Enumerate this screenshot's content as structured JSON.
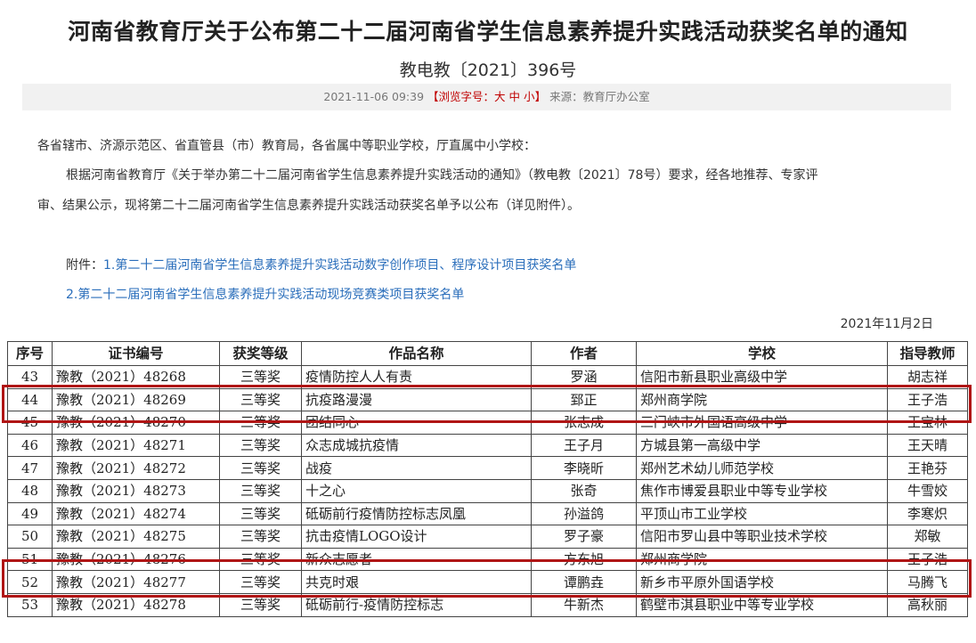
{
  "article": {
    "title": "河南省教育厅关于公布第二十二届河南省学生信息素养提升实践活动获奖名单的通知",
    "doc_no": "教电教〔2021〕396号",
    "datetime": "2021-11-06 09:39",
    "font_label_open": "【浏览字号：",
    "font_large": "大",
    "font_medium": "中",
    "font_small": "小",
    "font_label_close": "】",
    "source": "来源：教育厅办公室",
    "greeting": "各省辖市、济源示范区、省直管县（市）教育局，各省属中等职业学校，厅直属中小学校：",
    "body_line1": "根据河南省教育厅《关于举办第二十二届河南省学生信息素养提升实践活动的通知》（教电教〔2021〕78号）要求，经各地推荐、专家评",
    "body_line2": "审、结果公示，现将第二十二届河南省学生信息素养提升实践活动获奖名单予以公布（详见附件）。",
    "attach_label": "附件：",
    "attach1": "1.第二十二届河南省学生信息素养提升实践活动数字创作项目、程序设计项目获奖名单",
    "attach2": "2.第二十二届河南省学生信息素养提升实践活动现场竞赛类项目获奖名单",
    "date": "2021年11月2日"
  },
  "table": {
    "headers": [
      "序号",
      "证书编号",
      "获奖等级",
      "作品名称",
      "作者",
      "学校",
      "指导教师"
    ],
    "rows": [
      [
        "43",
        "豫教（2021）48268",
        "三等奖",
        "疫情防控人人有责",
        "罗涵",
        "信阳市新县职业高级中学",
        "胡志祥"
      ],
      [
        "44",
        "豫教（2021）48269",
        "三等奖",
        "抗疫路漫漫",
        "郅正",
        "郑州商学院",
        "王子浩"
      ],
      [
        "45",
        "豫教（2021）48270",
        "三等奖",
        "团结同心",
        "张志成",
        "三门峡市外国语高级中学",
        "王宝林"
      ],
      [
        "46",
        "豫教（2021）48271",
        "三等奖",
        "众志成城抗疫情",
        "王子月",
        "方城县第一高级中学",
        "王天晴"
      ],
      [
        "47",
        "豫教（2021）48272",
        "三等奖",
        "战疫",
        "李晓昕",
        "郑州艺术幼儿师范学校",
        "王艳芬"
      ],
      [
        "48",
        "豫教（2021）48273",
        "三等奖",
        "十之心",
        "张奇",
        "焦作市博爱县职业中等专业学校",
        "牛雪姣"
      ],
      [
        "49",
        "豫教（2021）48274",
        "三等奖",
        "砥砺前行疫情防控标志凤凰",
        "孙溢鸽",
        "平顶山市工业学校",
        "李寒炽"
      ],
      [
        "50",
        "豫教（2021）48275",
        "三等奖",
        "抗击疫情LOGO设计",
        "罗子豪",
        "信阳市罗山县中等职业技术学校",
        "郑敏"
      ],
      [
        "51",
        "豫教（2021）48276",
        "三等奖",
        "新众志愿者",
        "方东旭",
        "郑州商学院",
        "王子浩"
      ],
      [
        "52",
        "豫教（2021）48277",
        "三等奖",
        "共克时艰",
        "谭鹏垚",
        "新乡市平原外国语学校",
        "马腾飞"
      ],
      [
        "53",
        "豫教（2021）48278",
        "三等奖",
        "砥砺前行-疫情防控标志",
        "牛新杰",
        "鹤壁市淇县职业中等专业学校",
        "高秋丽"
      ]
    ]
  }
}
